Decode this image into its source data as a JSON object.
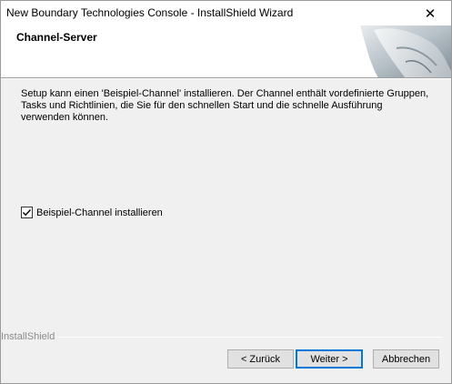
{
  "window": {
    "title": "New Boundary Technologies Console - InstallShield Wizard",
    "close_label": "✕"
  },
  "header": {
    "title": "Channel-Server"
  },
  "body": {
    "description": "Setup kann einen 'Beispiel-Channel' installieren. Der Channel enthält vordefinierte Gruppen, Tasks und Richtlinien, die Sie für den schnellen Start und die schnelle Ausführung verwenden können.",
    "checkbox_label": "Beispiel-Channel installieren",
    "checkbox_checked": true
  },
  "footer": {
    "brand": "InstallShield",
    "back_label": "< Zurück",
    "next_label": "Weiter >",
    "cancel_label": "Abbrechen"
  },
  "colors": {
    "accent": "#0078d7",
    "dialog_bg": "#f0f0f0"
  }
}
